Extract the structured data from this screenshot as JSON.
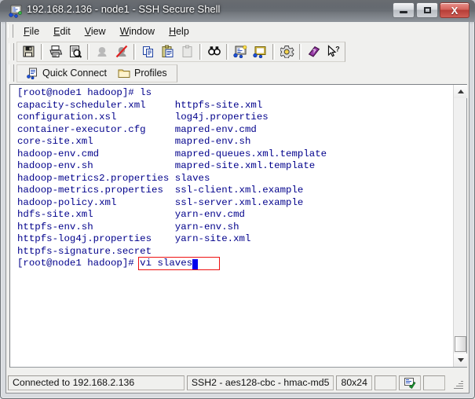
{
  "window": {
    "title": "192.168.2.136 - node1 - SSH Secure Shell",
    "app_icon": "ssh-terminal-icon",
    "controls": {
      "minimize": "minimize",
      "maximize": "maximize",
      "close": "X"
    }
  },
  "menubar": {
    "items": [
      {
        "label": "File",
        "mnemonic": "F"
      },
      {
        "label": "Edit",
        "mnemonic": "E"
      },
      {
        "label": "View",
        "mnemonic": "V"
      },
      {
        "label": "Window",
        "mnemonic": "W"
      },
      {
        "label": "Help",
        "mnemonic": "H"
      }
    ]
  },
  "toolbar": {
    "groups": [
      [
        "save-icon"
      ],
      [
        "print-icon",
        "print-preview-icon"
      ],
      [
        "connect-icon",
        "disconnect-icon"
      ],
      [
        "copy-icon",
        "paste-icon",
        "paste-disabled-icon"
      ],
      [
        "find-icon"
      ],
      [
        "new-terminal-icon",
        "new-file-transfer-icon"
      ],
      [
        "settings-icon"
      ],
      [
        "help-book-icon",
        "context-help-icon"
      ]
    ]
  },
  "quickbar": {
    "items": [
      {
        "label": "Quick Connect",
        "icon": "quick-connect-icon"
      },
      {
        "label": "Profiles",
        "icon": "profiles-folder-icon"
      }
    ]
  },
  "terminal": {
    "foreground": "#00008b",
    "background": "#ffffff",
    "cursor_color": "#0000ee",
    "highlight_box_color": "#ee1111",
    "lines": [
      "[root@node1 hadoop]# ls",
      "capacity-scheduler.xml     httpfs-site.xml",
      "configuration.xsl          log4j.properties",
      "container-executor.cfg     mapred-env.cmd",
      "core-site.xml              mapred-env.sh",
      "hadoop-env.cmd             mapred-queues.xml.template",
      "hadoop-env.sh              mapred-site.xml.template",
      "hadoop-metrics2.properties slaves",
      "hadoop-metrics.properties  ssl-client.xml.example",
      "hadoop-policy.xml          ssl-server.xml.example",
      "hdfs-site.xml              yarn-env.cmd",
      "httpfs-env.sh              yarn-env.sh",
      "httpfs-log4j.properties    yarn-site.xml",
      "httpfs-signature.secret"
    ],
    "prompt": "[root@node1 hadoop]# ",
    "command": "vi slaves"
  },
  "scrollbar": {
    "up_arrow": "scroll-up-arrow",
    "down_arrow": "scroll-down-arrow",
    "thumb": "scroll-thumb"
  },
  "statusbar": {
    "connection": "Connected to 192.168.2.136",
    "cipher": "SSH2 - aes128-cbc - hmac-md5",
    "size": "80x24",
    "indicator_icon": "encryption-indicator-icon"
  }
}
